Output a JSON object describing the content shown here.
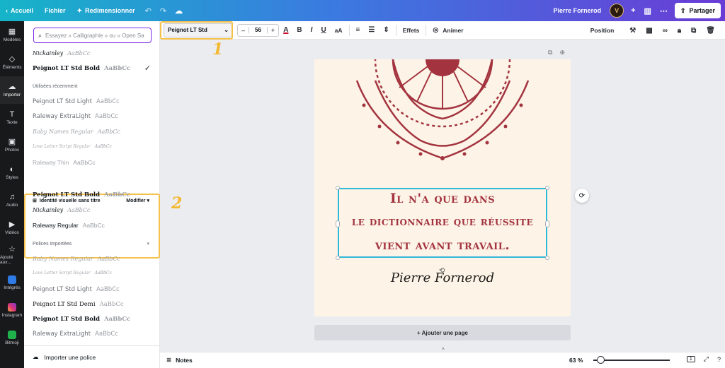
{
  "topbar": {
    "home": "Accueil",
    "file": "Fichier",
    "resize": "Redimensionner",
    "user_name": "Pierre Fornerod",
    "avatar_letter": "V",
    "share": "Partager"
  },
  "rail": {
    "items": [
      {
        "label": "Modèles",
        "icon": "layout-icon"
      },
      {
        "label": "Éléments",
        "icon": "shapes-icon"
      },
      {
        "label": "Importer",
        "icon": "upload-icon"
      },
      {
        "label": "Texte",
        "icon": "text-icon"
      },
      {
        "label": "Photos",
        "icon": "photo-icon"
      },
      {
        "label": "Styles",
        "icon": "palette-icon"
      },
      {
        "label": "Audio",
        "icon": "music-icon"
      },
      {
        "label": "Vidéos",
        "icon": "video-icon"
      },
      {
        "label": "Ajouté aux...",
        "icon": "star-icon"
      },
      {
        "label": "Intégrés",
        "icon": "grid-icon"
      },
      {
        "label": "Instagram",
        "icon": "instagram-icon"
      },
      {
        "label": "Bitmoji",
        "icon": "bitmoji-icon"
      }
    ]
  },
  "panel": {
    "search_placeholder": "Essayez « Calligraphie » ou « Open Sa",
    "top_fonts": [
      {
        "name": "Nickainley",
        "sample": "AaBbCc"
      },
      {
        "name": "Peignot LT Std Bold",
        "sample": "AaBbCc"
      }
    ],
    "recent_title": "Utilisées récemment",
    "recent_fonts": [
      {
        "name": "Peignot LT Std Light",
        "sample": "AaBbCc"
      },
      {
        "name": "Raleway ExtraLight",
        "sample": "AaBbCc"
      },
      {
        "name": "Baby Names Regular",
        "sample": "AaBbCc"
      },
      {
        "name": "Love Letter Script Regular",
        "sample": "AaBbCc"
      },
      {
        "name": "Raleway Thin",
        "sample": "AaBbCc"
      }
    ],
    "brand_title": "Identité visuelle sans titre",
    "brand_modify": "Modifier",
    "brand_fonts": [
      {
        "name": "Peignot LT Std Bold",
        "sample": "AaBbCc"
      },
      {
        "name": "Nickainley",
        "sample": "AaBbCc"
      },
      {
        "name": "Raleway Regular",
        "sample": "AaBbCc"
      }
    ],
    "imported_title": "Polices importées",
    "imported_fonts": [
      {
        "name": "Baby Names Regular",
        "sample": "AaBbCc"
      },
      {
        "name": "Love Letter Script Regular",
        "sample": "AaBbCc"
      },
      {
        "name": "Peignot LT Std Light",
        "sample": "AaBbCc"
      },
      {
        "name": "Peignot LT Std Demi",
        "sample": "AaBbCc"
      },
      {
        "name": "Peignot LT Std Bold",
        "sample": "AaBbCc"
      },
      {
        "name": "Raleway ExtraLight",
        "sample": "AaBbCc"
      }
    ],
    "import_font": "Importer une police"
  },
  "toolbar": {
    "font": "Peignot LT Std",
    "size": "56",
    "effects": "Effets",
    "animate": "Animer",
    "position": "Position",
    "case_label": "aA"
  },
  "canvas": {
    "quote_lines": [
      "Il n'a que dans",
      "le dictionnaire que réussite",
      "vient avant travail."
    ],
    "signature": "Pierre Fornerod",
    "add_page": "+ Ajouter une page"
  },
  "bottombar": {
    "notes": "Notes",
    "zoom": "63 %",
    "zoom_fraction": 0.05,
    "page_count": "1"
  },
  "annotations": {
    "one": "1",
    "two": "2"
  },
  "colors": {
    "accent": "#7d2ae8",
    "highlight": "#f6c14a",
    "quote": "#a3343f",
    "page": "#fdf4e7"
  }
}
